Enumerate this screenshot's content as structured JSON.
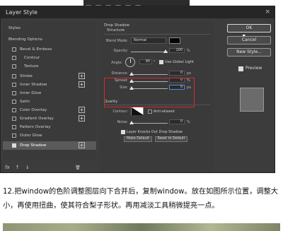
{
  "dialog": {
    "title": "Layer Style",
    "close_glyph": "×",
    "styles_list": [
      {
        "label": "Styles",
        "checkbox": false,
        "plus": false,
        "checked": false
      },
      {
        "label": "Blending Options",
        "checkbox": false,
        "plus": false,
        "checked": false
      },
      {
        "label": "Bevel & Emboss",
        "checkbox": true,
        "plus": false,
        "checked": false
      },
      {
        "label": "Contour",
        "checkbox": true,
        "plus": false,
        "checked": false,
        "indent": true
      },
      {
        "label": "Texture",
        "checkbox": true,
        "plus": false,
        "checked": false,
        "indent": true
      },
      {
        "label": "Stroke",
        "checkbox": true,
        "plus": true,
        "checked": false
      },
      {
        "label": "Inner Shadow",
        "checkbox": true,
        "plus": true,
        "checked": false
      },
      {
        "label": "Inner Glow",
        "checkbox": true,
        "plus": false,
        "checked": false
      },
      {
        "label": "Satin",
        "checkbox": true,
        "plus": false,
        "checked": false
      },
      {
        "label": "Color Overlay",
        "checkbox": true,
        "plus": true,
        "checked": false
      },
      {
        "label": "Gradient Overlay",
        "checkbox": true,
        "plus": true,
        "checked": false
      },
      {
        "label": "Pattern Overlay",
        "checkbox": true,
        "plus": false,
        "checked": false
      },
      {
        "label": "Outer Glow",
        "checkbox": true,
        "plus": false,
        "checked": false
      },
      {
        "label": "Drop Shadow",
        "checkbox": true,
        "plus": true,
        "checked": true,
        "selected": true
      }
    ],
    "footer_fx": "fx",
    "footer_up": "↑",
    "footer_down": "↓",
    "footer_trash": "🗑",
    "panel": {
      "section_title": "Drop Shadow",
      "structure_label": "Structure",
      "blend_mode_label": "Blend Mode:",
      "blend_mode_value": "Normal",
      "opacity_label": "Opacity:",
      "opacity_value": "100",
      "angle_label": "Angle:",
      "angle_value": "90",
      "use_global_light": "Use Global Light",
      "distance_label": "Distance:",
      "distance_value": "0",
      "spread_label": "Spread:",
      "spread_value": "0",
      "size_label": "Size:",
      "size_value": "0",
      "unit_px": "px",
      "unit_pct": "%",
      "unit_deg": "°",
      "quality_label": "Quality",
      "contour_label": "Contour:",
      "anti_aliased": "Anti-aliased",
      "noise_label": "Noise:",
      "noise_value": "0",
      "knockout_label": "Layer Knocks Out Drop Shadow",
      "make_default": "Make Default",
      "reset_default": "Reset to Default"
    },
    "buttons": {
      "ok": "OK",
      "cancel": "Cancel",
      "new_style": "New Style...",
      "preview": "Preview"
    }
  },
  "article": {
    "paragraph": "12.把window的色阶调整图层向下合并后，复制window。放在如图所示位置，调整大小，再使用扭曲，使其符合梨子形状。再用减淡工具稍微提亮一点。"
  }
}
